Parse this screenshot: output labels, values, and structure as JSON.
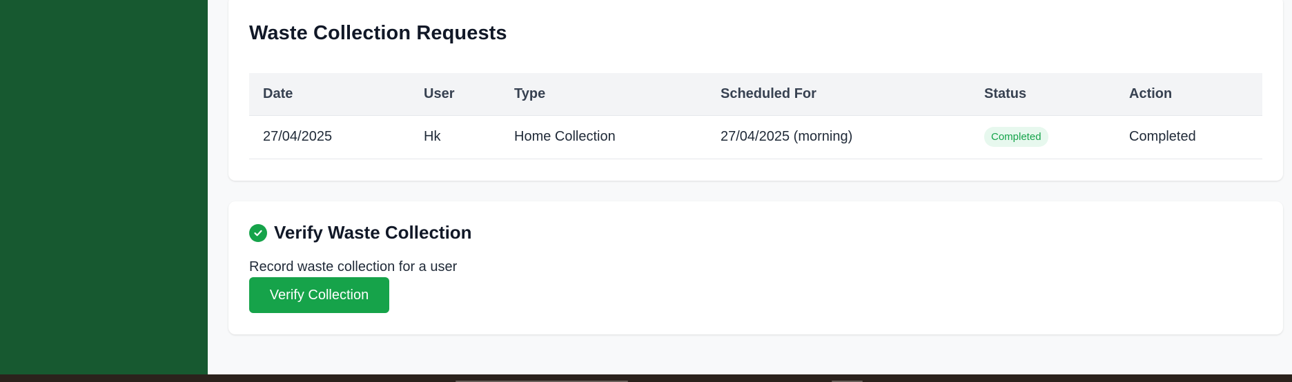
{
  "requests": {
    "title": "Waste Collection Requests",
    "columns": [
      "Date",
      "User",
      "Type",
      "Scheduled For",
      "Status",
      "Action"
    ],
    "rows": [
      {
        "date": "27/04/2025",
        "user": "Hk",
        "type": "Home Collection",
        "scheduled_for": "27/04/2025 (morning)",
        "status": "Completed",
        "action": "Completed"
      }
    ]
  },
  "verify": {
    "title": "Verify Waste Collection",
    "description": "Record waste collection for a user",
    "button_label": "Verify Collection",
    "icon": "check-circle-icon"
  },
  "colors": {
    "sidebar": "#175930",
    "accent": "#16a34a",
    "status_bg": "#e7f8ee",
    "page_bg": "#f8f9fa"
  }
}
